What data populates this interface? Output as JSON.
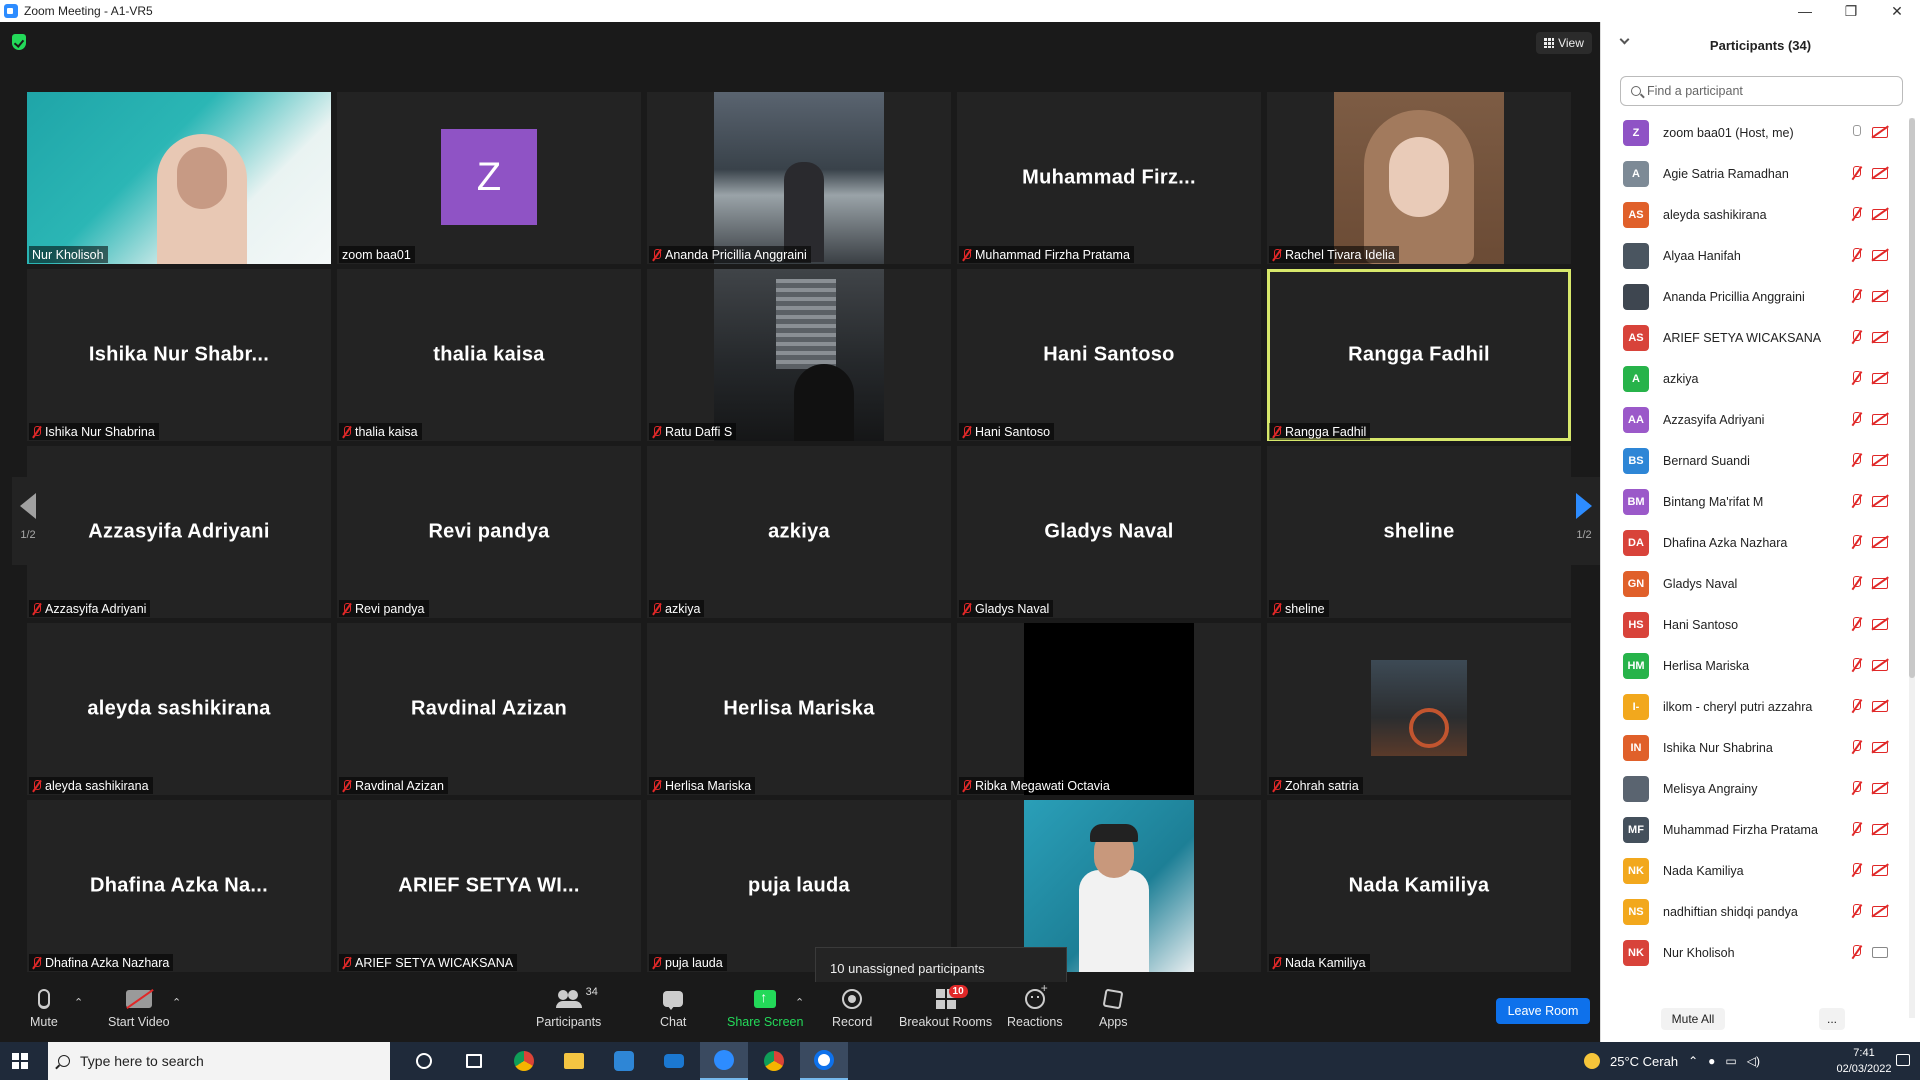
{
  "window": {
    "title": "Zoom Meeting - A1-VR5",
    "minimize": "—",
    "maximize": "❐",
    "close": "✕"
  },
  "view_button": "View",
  "tiles": [
    {
      "big": "",
      "tag": "Nur Kholisoh",
      "muted": false,
      "video": "teal"
    },
    {
      "big": "",
      "tag": "zoom baa01",
      "muted": false,
      "avatar": "Z"
    },
    {
      "big": "",
      "tag": "Ananda Pricillia Anggraini",
      "muted": true,
      "video": "street"
    },
    {
      "big": "Muhammad  Firz...",
      "tag": "Muhammad Firzha Pratama",
      "muted": true
    },
    {
      "big": "",
      "tag": "Rachel Tivara Idelia",
      "muted": true,
      "video": "hijab"
    },
    {
      "big": "Ishika  Nur  Shabr...",
      "tag": "Ishika Nur Shabrina",
      "muted": true
    },
    {
      "big": "thalia kaisa",
      "tag": "thalia kaisa",
      "muted": true
    },
    {
      "big": "",
      "tag": "Ratu Daffi S",
      "muted": true,
      "video": "night"
    },
    {
      "big": "Hani Santoso",
      "tag": "Hani Santoso",
      "muted": true
    },
    {
      "big": "Rangga Fadhil",
      "tag": "Rangga Fadhil",
      "muted": true,
      "active": true
    },
    {
      "big": "Azzasyifa Adriyani",
      "tag": "Azzasyifa Adriyani",
      "muted": true
    },
    {
      "big": "Revi pandya",
      "tag": "Revi pandya",
      "muted": true
    },
    {
      "big": "azkiya",
      "tag": "azkiya",
      "muted": true
    },
    {
      "big": "Gladys Naval",
      "tag": "Gladys Naval",
      "muted": true
    },
    {
      "big": "sheline",
      "tag": "sheline",
      "muted": true
    },
    {
      "big": "aleyda sashikirana",
      "tag": "aleyda sashikirana",
      "muted": true
    },
    {
      "big": "Ravdinal Azizan",
      "tag": "Ravdinal Azizan",
      "muted": true
    },
    {
      "big": "Herlisa Mariska",
      "tag": "Herlisa Mariska",
      "muted": true
    },
    {
      "big": "",
      "tag": "Ribka Megawati Octavia",
      "muted": true,
      "video": "black"
    },
    {
      "big": "",
      "tag": "Zohrah satria",
      "muted": true,
      "video": "moto"
    },
    {
      "big": "Dhafina  Azka  Na...",
      "tag": "Dhafina Azka Nazhara",
      "muted": true
    },
    {
      "big": "ARIEF  SETYA  WI...",
      "tag": "ARIEF SETYA WICAKSANA",
      "muted": true
    },
    {
      "big": "puja lauda",
      "tag": "puja lauda",
      "muted": true
    },
    {
      "big": "",
      "tag": "",
      "muted": false,
      "video": "girl"
    },
    {
      "big": "Nada Kamiliya",
      "tag": "Nada Kamiliya",
      "muted": true
    }
  ],
  "pager": {
    "left": "1/2",
    "right": "1/2"
  },
  "unassigned": "10 unassigned participants",
  "toolbar": {
    "mute": "Mute",
    "start_video": "Start Video",
    "participants": "Participants",
    "participants_count": "34",
    "chat": "Chat",
    "share_screen": "Share Screen",
    "record": "Record",
    "breakout_rooms": "Breakout Rooms",
    "breakout_badge": "10",
    "reactions": "Reactions",
    "apps": "Apps",
    "leave": "Leave Room",
    "caret": "⌃"
  },
  "panel": {
    "title": "Participants (34)",
    "search_placeholder": "Find a participant",
    "mute_all": "Mute All",
    "more": "...",
    "participants": [
      {
        "initials": "Z",
        "name": "zoom baa01 (Host, me)",
        "color": "#8f53c5",
        "mic": "on",
        "cam": "off"
      },
      {
        "initials": "A",
        "name": "Agie Satria Ramadhan",
        "color": "#7d8a96",
        "mic": "off",
        "cam": "off"
      },
      {
        "initials": "AS",
        "name": "aleyda sashikirana",
        "color": "#e0602a",
        "mic": "off",
        "cam": "off"
      },
      {
        "initials": "",
        "name": "Alyaa Hanifah",
        "color": "#4a5560",
        "mic": "off",
        "cam": "off"
      },
      {
        "initials": "",
        "name": "Ananda Pricillia Anggraini",
        "color": "#3e4650",
        "mic": "off",
        "cam": "off"
      },
      {
        "initials": "AS",
        "name": "ARIEF SETYA WICAKSANA",
        "color": "#d8433a",
        "mic": "off",
        "cam": "off"
      },
      {
        "initials": "A",
        "name": "azkiya",
        "color": "#27b34a",
        "mic": "off",
        "cam": "off"
      },
      {
        "initials": "AA",
        "name": "Azzasyifa Adriyani",
        "color": "#9b59c9",
        "mic": "off",
        "cam": "off"
      },
      {
        "initials": "BS",
        "name": "Bernard Suandi",
        "color": "#2e86d6",
        "mic": "off",
        "cam": "off"
      },
      {
        "initials": "BM",
        "name": "Bintang Ma'rifat M",
        "color": "#9b59c9",
        "mic": "off",
        "cam": "off"
      },
      {
        "initials": "DA",
        "name": "Dhafina Azka Nazhara",
        "color": "#d8433a",
        "mic": "off",
        "cam": "off"
      },
      {
        "initials": "GN",
        "name": "Gladys Naval",
        "color": "#e0602a",
        "mic": "off",
        "cam": "off"
      },
      {
        "initials": "HS",
        "name": "Hani Santoso",
        "color": "#d8433a",
        "mic": "off",
        "cam": "off"
      },
      {
        "initials": "HM",
        "name": "Herlisa Mariska",
        "color": "#27b34a",
        "mic": "off",
        "cam": "off"
      },
      {
        "initials": "I-",
        "name": "ilkom - cheryl putri azzahra",
        "color": "#f2a81d",
        "mic": "off",
        "cam": "off"
      },
      {
        "initials": "IN",
        "name": "Ishika Nur Shabrina",
        "color": "#e0602a",
        "mic": "off",
        "cam": "off"
      },
      {
        "initials": "",
        "name": "Melisya Angrainy",
        "color": "#5a6470",
        "mic": "off",
        "cam": "off"
      },
      {
        "initials": "MF",
        "name": "Muhammad Firzha Pratama",
        "color": "#44505c",
        "mic": "off",
        "cam": "off"
      },
      {
        "initials": "NK",
        "name": "Nada Kamiliya",
        "color": "#f2a81d",
        "mic": "off",
        "cam": "off"
      },
      {
        "initials": "NS",
        "name": "nadhiftian shidqi pandya",
        "color": "#f2a81d",
        "mic": "off",
        "cam": "off"
      },
      {
        "initials": "NK",
        "name": "Nur Kholisoh",
        "color": "#d8433a",
        "mic": "off",
        "cam": "on"
      }
    ]
  },
  "taskbar": {
    "search_placeholder": "Type here to search",
    "weather": "25°C  Cerah",
    "time": "7:41",
    "date": "02/03/2022"
  }
}
